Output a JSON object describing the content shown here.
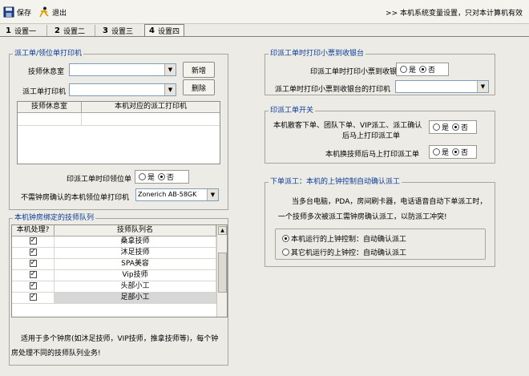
{
  "toolbar": {
    "save_label": "保存",
    "exit_label": "退出",
    "notice": ">> 本机系统变量设置，只对本计算机有效",
    "save_icon": "floppy-icon",
    "exit_icon": "running-man-icon"
  },
  "tabs": [
    {
      "num": "1",
      "label": "设置一",
      "active": false
    },
    {
      "num": "2",
      "label": "设置二",
      "active": false
    },
    {
      "num": "3",
      "label": "设置三",
      "active": false
    },
    {
      "num": "4",
      "label": "设置四",
      "active": true
    }
  ],
  "dispatch_printer": {
    "title": "派工单/领位单打印机",
    "lounge_label": "技师休息室",
    "lounge_value": "",
    "printer_label": "派工单打印机",
    "printer_value": "",
    "add_button": "新增",
    "delete_button": "删除",
    "table_headers": [
      "技师休息室",
      "本机对应的派工打印机"
    ],
    "print_seat_label": "印派工单时印领位单",
    "yes": "是",
    "no": "否",
    "print_seat_value": "no",
    "no_confirm_label": "不需钟房确认的本机领位单打印机",
    "no_confirm_value": "Zonerich AB-58GK"
  },
  "receipt_printer": {
    "title": "印派工单时打印小票到收银台",
    "print_receipt_label": "印派工单时打印小票到收银台",
    "print_receipt_value": "no",
    "receipt_printer_label": "派工单时打印小票到收银台的打印机",
    "receipt_printer_value": "",
    "yes": "是",
    "no": "否"
  },
  "dispatch_switch": {
    "title": "印派工单开关",
    "guest_order_label_1": "本机散客下单、团队下单、VIP派工、派工确认",
    "guest_order_label_2": "后马上打印派工单",
    "guest_order_value": "no",
    "change_tech_label": "本机换技师后马上打印派工单",
    "change_tech_value": "no",
    "yes": "是",
    "no": "否"
  },
  "queue_group": {
    "title": "本机钟房绑定的技师队列",
    "headers": [
      "本机处理?",
      "技师队列名"
    ],
    "rows": [
      {
        "checked": true,
        "name": "桑拿技师",
        "selected": false
      },
      {
        "checked": true,
        "name": "沐足技师",
        "selected": false
      },
      {
        "checked": true,
        "name": "SPA美容",
        "selected": false
      },
      {
        "checked": true,
        "name": "Vip技师",
        "selected": false
      },
      {
        "checked": true,
        "name": "头部小工",
        "selected": false
      },
      {
        "checked": true,
        "name": "足部小工",
        "selected": true
      }
    ],
    "footnote_1": "适用于多个钟房(如沐足技师，VIP技师，推拿技师等)，每个钟",
    "footnote_2": "房处理不同的技师队列业务!"
  },
  "auto_confirm": {
    "title": "下单派工：本机的上钟控制自动确认派工",
    "desc_1": "当多台电脑，PDA，房间刷卡器，电话语音自动下单派工时，",
    "desc_2": "一个技师多次被派工需钟房确认派工，以防派工冲突!",
    "option_1": "本机运行的上钟控制：自动确认派工",
    "option_2": "其它机运行的上钟控：自动确认派工",
    "selected": 1
  }
}
